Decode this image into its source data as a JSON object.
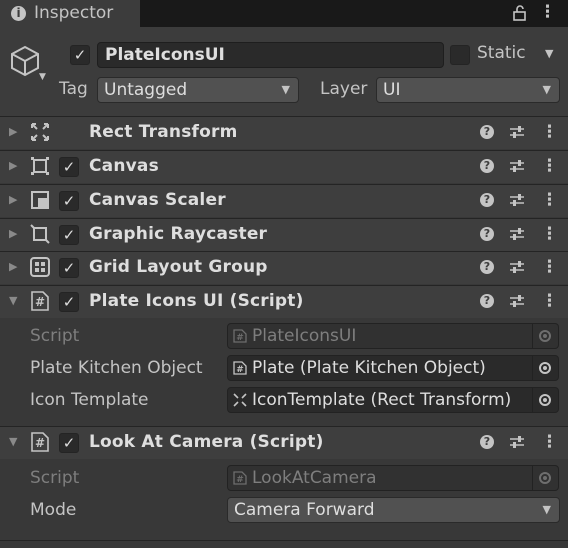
{
  "window": {
    "tab_title": "Inspector"
  },
  "gameobject": {
    "active": true,
    "name": "PlateIconsUI",
    "static_label": "Static",
    "static_checked": false,
    "tag_label": "Tag",
    "tag_value": "Untagged",
    "layer_label": "Layer",
    "layer_value": "UI"
  },
  "components": [
    {
      "title": "Rect Transform",
      "has_checkbox": false,
      "expanded": false,
      "icon": "rect-transform-icon"
    },
    {
      "title": "Canvas",
      "has_checkbox": true,
      "enabled": true,
      "expanded": false,
      "icon": "canvas-icon"
    },
    {
      "title": "Canvas Scaler",
      "has_checkbox": true,
      "enabled": true,
      "expanded": false,
      "icon": "canvas-scaler-icon"
    },
    {
      "title": "Graphic Raycaster",
      "has_checkbox": true,
      "enabled": true,
      "expanded": false,
      "icon": "graphic-raycaster-icon"
    },
    {
      "title": "Grid Layout Group",
      "has_checkbox": true,
      "enabled": true,
      "expanded": false,
      "icon": "grid-layout-icon"
    },
    {
      "title": "Plate Icons UI (Script)",
      "has_checkbox": true,
      "enabled": true,
      "expanded": true,
      "icon": "script-icon"
    },
    {
      "title": "Look At Camera (Script)",
      "has_checkbox": true,
      "enabled": true,
      "expanded": true,
      "icon": "script-icon"
    }
  ],
  "plate_icons_ui": {
    "script_label": "Script",
    "script_value": "PlateIconsUI",
    "plate_label": "Plate Kitchen Object",
    "plate_value": "Plate (Plate Kitchen Object)",
    "template_label": "Icon Template",
    "template_value": "IconTemplate (Rect Transform)"
  },
  "look_at_camera": {
    "script_label": "Script",
    "script_value": "LookAtCamera",
    "mode_label": "Mode",
    "mode_value": "Camera Forward"
  },
  "icons": {
    "help": "?",
    "kebab": "⋮",
    "check": "✓",
    "foldout_closed": "▶",
    "foldout_open": "▼",
    "dropdown": "▼",
    "script_glyph": "#"
  },
  "colors": {
    "panel": "#383838",
    "header": "#3e3e3e",
    "field": "#2a2a2a",
    "text": "#c4c4c4"
  }
}
